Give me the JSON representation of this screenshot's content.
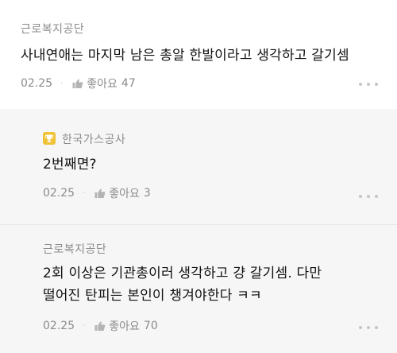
{
  "comments": [
    {
      "author": "근로복지공단",
      "text": "사내연애는 마지막 남은 총알 한발이라고 생각하고 갈기셈",
      "date": "02.25",
      "like_label": "좋아요",
      "like_count": "47"
    }
  ],
  "replies": [
    {
      "author": "한국가스공사",
      "badge": "trophy-icon",
      "text": "2번째면?",
      "date": "02.25",
      "like_label": "좋아요",
      "like_count": "3"
    },
    {
      "author": "근로복지공단",
      "text_line1": "2회 이상은 기관총이러 생각하고 걍 갈기셈. 다만",
      "text_line2": "떨어진 탄피는 본인이 챙겨야한다 ㅋㅋ",
      "date": "02.25",
      "like_label": "좋아요",
      "like_count": "70"
    }
  ],
  "icons": {
    "like": "thumbs-up-icon",
    "more": "more-dots-icon",
    "separator": "·"
  },
  "colors": {
    "reply_background": "#f6f6f6",
    "meta_text": "#8b8b8b",
    "badge": "#f0c236"
  }
}
